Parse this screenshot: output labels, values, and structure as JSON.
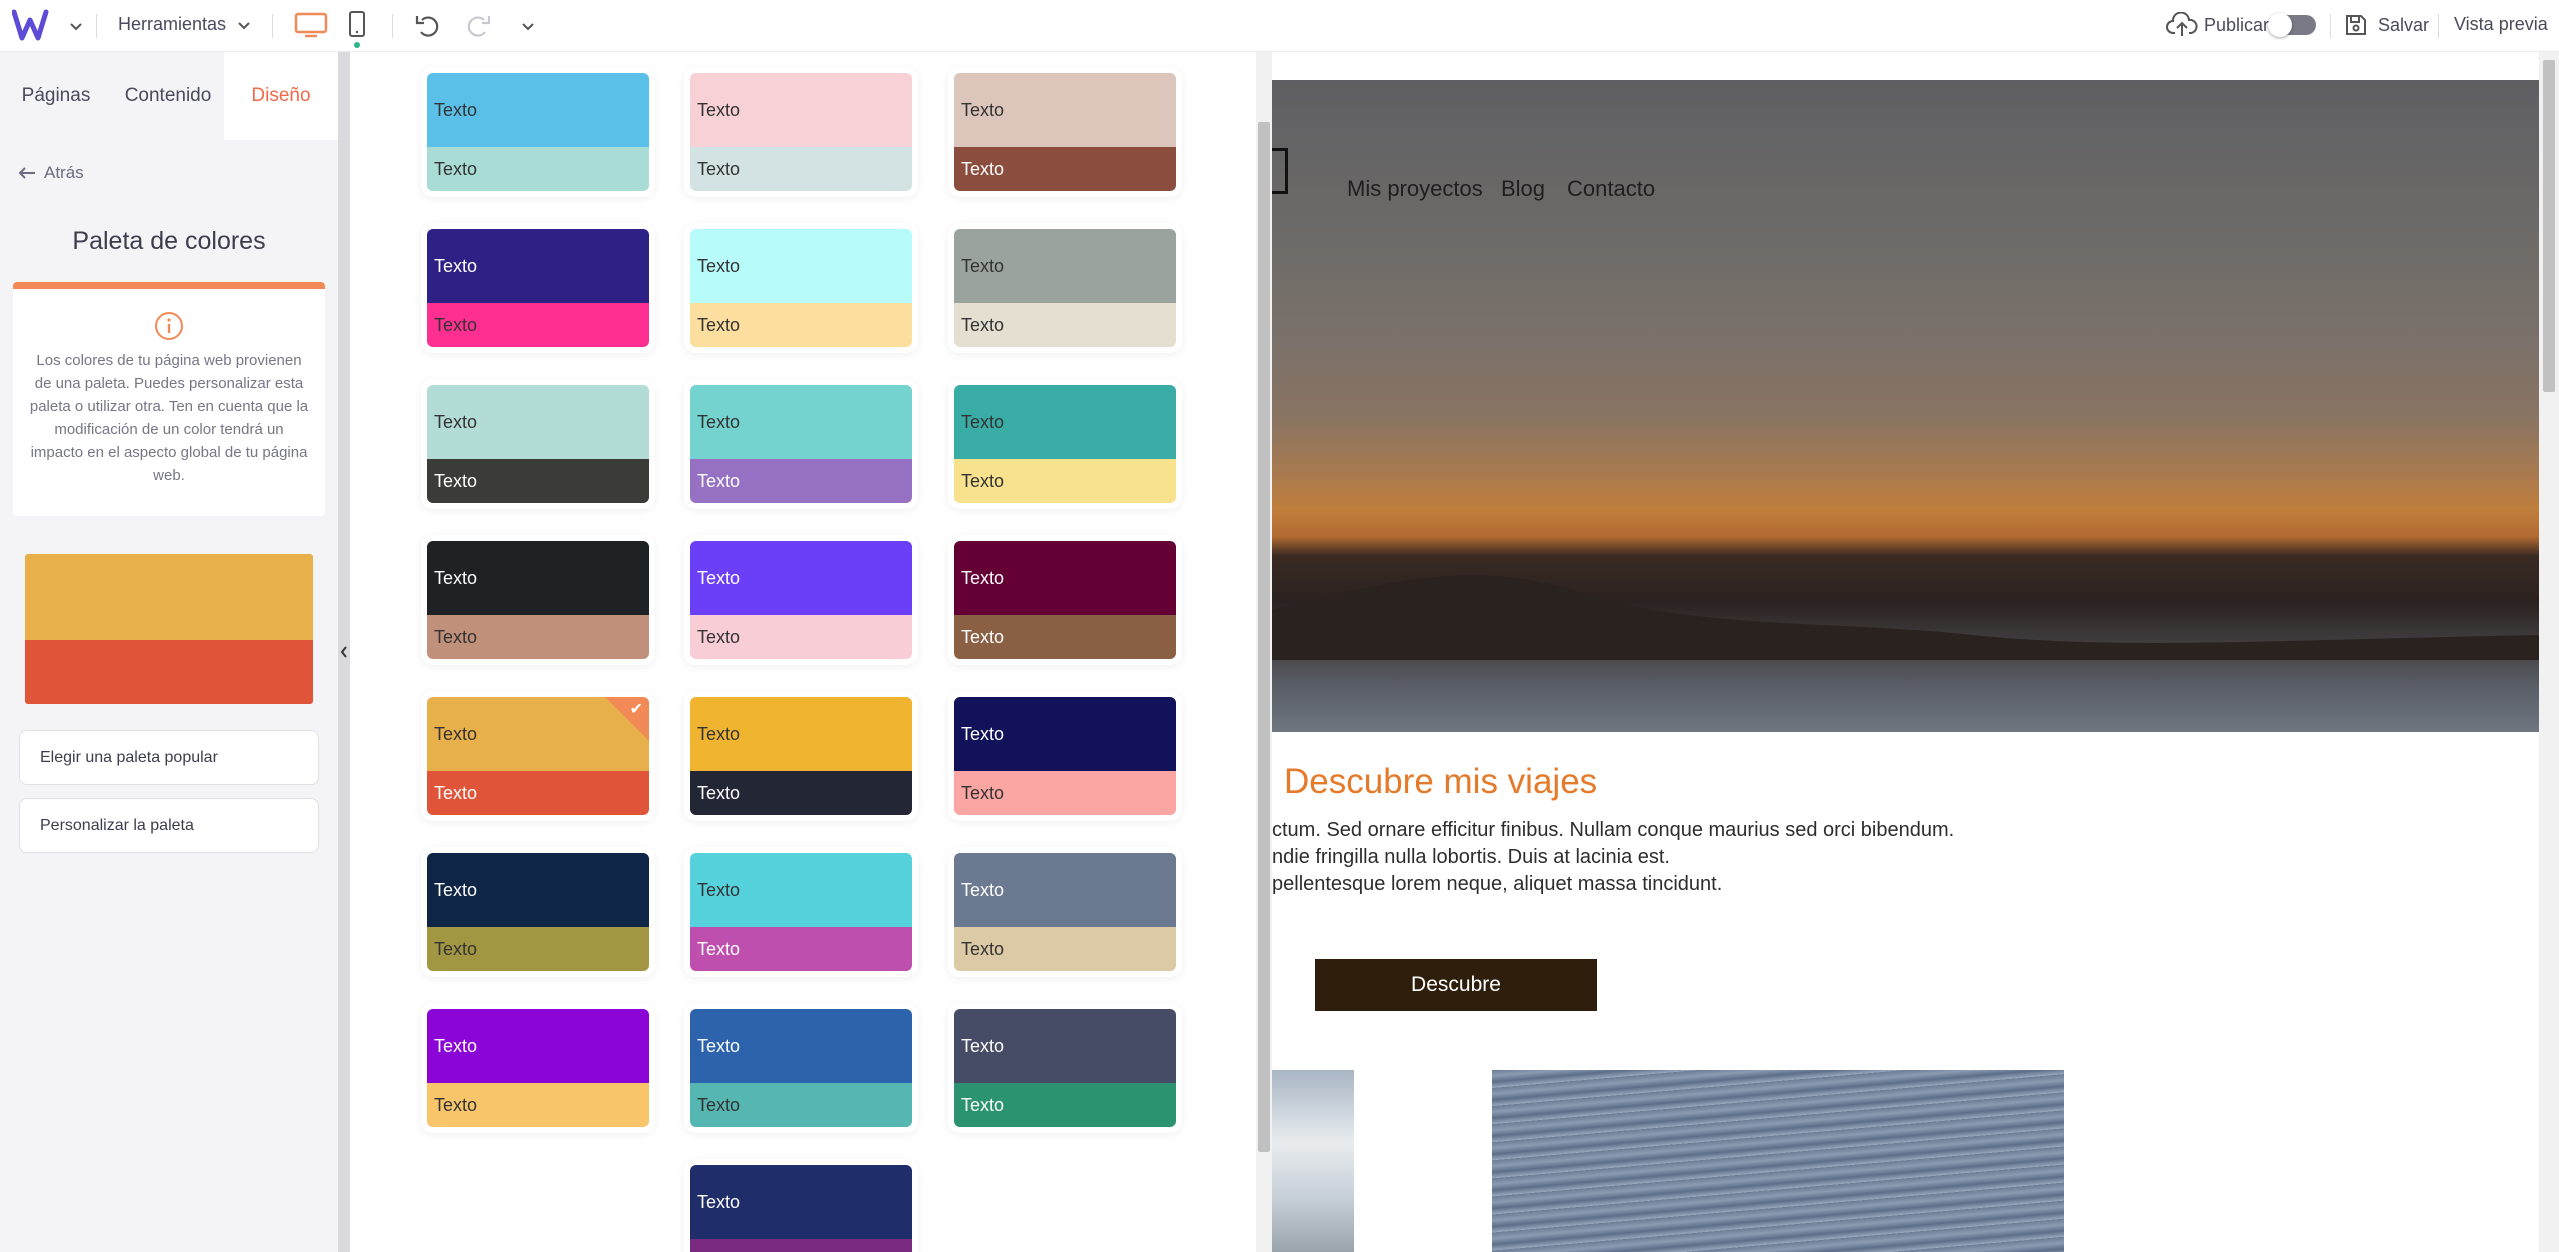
{
  "topbar": {
    "tools_label": "Herramientas",
    "publish_label": "Publicar",
    "save_label": "Salvar",
    "preview_label": "Vista previa",
    "brand_color": "#5b4bd6",
    "accent_color": "#f28a58"
  },
  "sidebar": {
    "tabs": [
      {
        "label": "Páginas"
      },
      {
        "label": "Contenido"
      },
      {
        "label": "Diseño"
      }
    ],
    "back_label": "Atrás",
    "title": "Paleta de colores",
    "info_text": "Los colores de tu página web provienen de una paleta. Puedes personalizar esta paleta o utilizar otra. Ten en cuenta que la modificación de un color tendrá un impacto en el aspecto global de tu página web.",
    "current_palette": {
      "primary": "#e8b04a",
      "secondary": "#e0553a"
    },
    "choose_popular_label": "Elegir una paleta popular",
    "customize_label": "Personalizar la paleta"
  },
  "palettes": [
    {
      "text": "Texto",
      "top": "#5bc0e8",
      "top_fg": "#333333",
      "bottom": "#a8dcd4",
      "bottom_fg": "#333333"
    },
    {
      "text": "Texto",
      "top": "#f7d1d6",
      "top_fg": "#333333",
      "bottom": "#d3e3e3",
      "bottom_fg": "#333333"
    },
    {
      "text": "Texto",
      "top": "#dcc6bb",
      "top_fg": "#333333",
      "bottom": "#8b4d3e",
      "bottom_fg": "#ffffff"
    },
    {
      "text": "Texto",
      "top": "#2d2185",
      "top_fg": "#ffffff",
      "bottom": "#ff2f92",
      "bottom_fg": "#333333"
    },
    {
      "text": "Texto",
      "top": "#b8fbfb",
      "top_fg": "#333333",
      "bottom": "#fcde9e",
      "bottom_fg": "#333333"
    },
    {
      "text": "Texto",
      "top": "#9aa39e",
      "top_fg": "#333333",
      "bottom": "#e4dfd0",
      "bottom_fg": "#333333"
    },
    {
      "text": "Texto",
      "top": "#b4dcd6",
      "top_fg": "#333333",
      "bottom": "#3b3b38",
      "bottom_fg": "#ffffff"
    },
    {
      "text": "Texto",
      "top": "#74d3ce",
      "top_fg": "#333333",
      "bottom": "#9670c2",
      "bottom_fg": "#ffffff"
    },
    {
      "text": "Texto",
      "top": "#3aaca6",
      "top_fg": "#333333",
      "bottom": "#f8e28e",
      "bottom_fg": "#333333"
    },
    {
      "text": "Texto",
      "top": "#1e2225",
      "top_fg": "#ffffff",
      "bottom": "#c0907a",
      "bottom_fg": "#333333"
    },
    {
      "text": "Texto",
      "top": "#6b3ff8",
      "top_fg": "#ffffff",
      "bottom": "#f9cdd6",
      "bottom_fg": "#333333"
    },
    {
      "text": "Texto",
      "top": "#640033",
      "top_fg": "#ffffff",
      "bottom": "#8a5f44",
      "bottom_fg": "#ffffff"
    },
    {
      "text": "Texto",
      "top": "#e8b04a",
      "top_fg": "#333333",
      "bottom": "#e0553a",
      "bottom_fg": "#ffffff",
      "selected": true
    },
    {
      "text": "Texto",
      "top": "#f0b431",
      "top_fg": "#333333",
      "bottom": "#232634",
      "bottom_fg": "#ffffff"
    },
    {
      "text": "Texto",
      "top": "#12125a",
      "top_fg": "#ffffff",
      "bottom": "#fba6a2",
      "bottom_fg": "#333333"
    },
    {
      "text": "Texto",
      "top": "#0e2545",
      "top_fg": "#ffffff",
      "bottom": "#a29643",
      "bottom_fg": "#333333"
    },
    {
      "text": "Texto",
      "top": "#56d2dd",
      "top_fg": "#333333",
      "bottom": "#bf4fae",
      "bottom_fg": "#ffffff"
    },
    {
      "text": "Texto",
      "top": "#6b7a90",
      "top_fg": "#ffffff",
      "bottom": "#dcc9a6",
      "bottom_fg": "#333333"
    },
    {
      "text": "Texto",
      "top": "#8b06d6",
      "top_fg": "#ffffff",
      "bottom": "#f8c56a",
      "bottom_fg": "#333333"
    },
    {
      "text": "Texto",
      "top": "#2d63ad",
      "top_fg": "#ffffff",
      "bottom": "#56b6b1",
      "bottom_fg": "#333333"
    },
    {
      "text": "Texto",
      "top": "#474c66",
      "top_fg": "#ffffff",
      "bottom": "#2c9370",
      "bottom_fg": "#ffffff"
    },
    {
      "text": "Texto",
      "top": "#1f2e6b",
      "top_fg": "#ffffff",
      "bottom": "#7a2a80",
      "bottom_fg": "#ffffff"
    }
  ],
  "preview": {
    "nav": [
      "Mis proyectos",
      "Blog",
      "Contacto"
    ],
    "section_title": "Descubre mis viajes",
    "paragraph_lines": [
      "ctum. Sed ornare efficitur finibus. Nullam conque maurius sed orci bibendum.",
      "ndie fringilla nulla lobortis. Duis at lacinia est.",
      "pellentesque lorem neque, aliquet massa tincidunt."
    ],
    "cta_label": "Descubre",
    "title_color": "#e47a2a"
  }
}
